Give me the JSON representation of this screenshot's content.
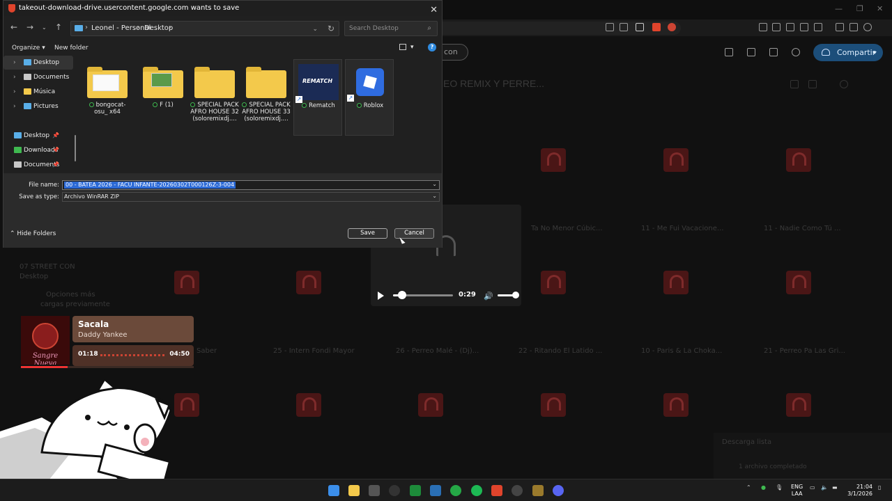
{
  "dialog": {
    "title": "takeout-download-drive.usercontent.google.com wants to save",
    "path": [
      "Leonel - Personal",
      "Desktop"
    ],
    "search_placeholder": "Search Desktop",
    "organize": "Organize",
    "new_folder": "New folder",
    "nav_tree": [
      {
        "label": "Desktop",
        "selected": true,
        "color": "#59aee8"
      },
      {
        "label": "Documents",
        "selected": false,
        "color": "#c8c8c8"
      },
      {
        "label": "Música",
        "selected": false,
        "color": "#f3c94b"
      },
      {
        "label": "Pictures",
        "selected": false,
        "color": "#59aee8"
      }
    ],
    "quick_access": [
      {
        "label": "Desktop",
        "color": "#59aee8"
      },
      {
        "label": "Downloads",
        "color": "#3fb950"
      },
      {
        "label": "Documents",
        "color": "#c8c8c8"
      }
    ],
    "files": [
      {
        "name": "bongocat-osu_ x64",
        "kind": "folder"
      },
      {
        "name": "F (1)",
        "kind": "folder"
      },
      {
        "name": "SPECIAL PACK AFRO HOUSE 32 (soloremixdj....",
        "kind": "folder"
      },
      {
        "name": "SPECIAL PACK AFRO HOUSE 33 (soloremixdj....",
        "kind": "folder"
      },
      {
        "name": "Rematch",
        "kind": "shortcut",
        "thumb_text": "REMATCH"
      },
      {
        "name": "Roblox",
        "kind": "shortcut"
      }
    ],
    "file_name_label": "File name:",
    "file_name_value": "00 - BATEA 2026 - FACU INFANTE-20260302T000126Z-3-004",
    "save_type_label": "Save as type:",
    "save_type_value": "Archivo WinRAR ZIP",
    "hide_folders": "Hide Folders",
    "save": "Save",
    "cancel": "Cancel"
  },
  "browser": {
    "share": "Compartir",
    "folder_title": "EO REMIX Y PERRE...",
    "pill_text": "con"
  },
  "drive_rows": {
    "row1": [
      "Ta No Menor Cúbic...",
      "11 - Me Fui Vacacione...",
      "11 - Nadie Como Tú ..."
    ],
    "row2": [
      "Saber",
      "25 - Intern Fondi Mayor",
      "26 - Perreo Malé - (Dj)...",
      "22 - Ritando El Latido ...",
      "10 - Paris & La Choka...",
      "21 - Perreo Pa Las Gri..."
    ]
  },
  "video": {
    "time": "0:29",
    "progress": 0.15
  },
  "now_playing": {
    "title": "Sacala",
    "artist": "Daddy Yankee",
    "album_text": "Sangre Nueva",
    "current": "01:18",
    "total": "04:50",
    "progress": 0.27
  },
  "side_faded": [
    "07 STREET CON",
    "Desktop",
    "Opciones más",
    "cargas previamente"
  ],
  "downloads_panel": {
    "title": "Descarga lista",
    "subtitle": "1 archivo completado"
  },
  "taskbar": {
    "lang_top": "ENG",
    "lang_bottom": "LAA",
    "time": "21:04",
    "date": "3/1/2026"
  }
}
